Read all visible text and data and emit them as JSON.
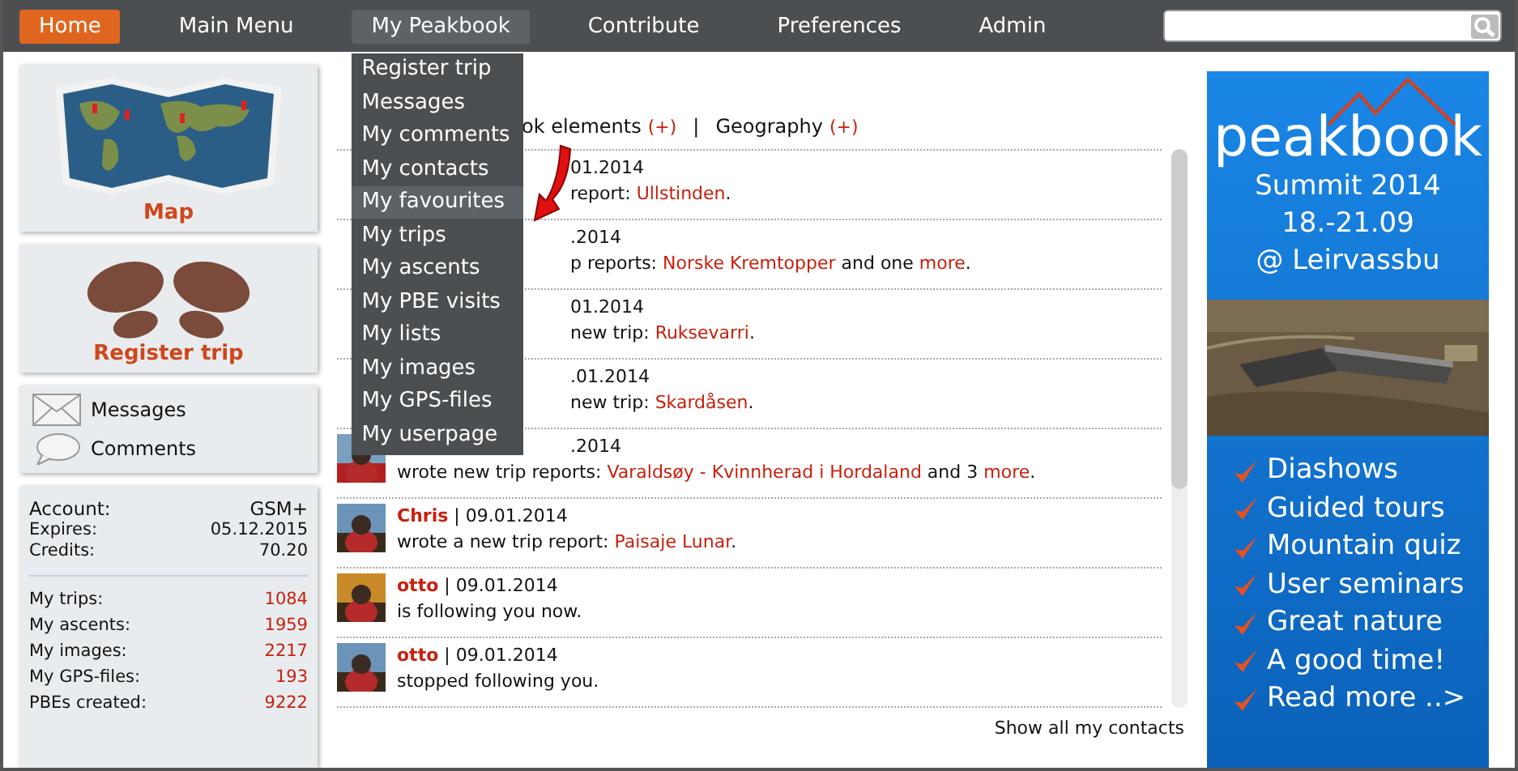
{
  "nav": {
    "items": [
      {
        "label": "Home",
        "selected": true,
        "open": false
      },
      {
        "label": "Main Menu",
        "selected": false,
        "open": false
      },
      {
        "label": "My Peakbook",
        "selected": false,
        "open": true
      },
      {
        "label": "Contribute",
        "selected": false,
        "open": false
      },
      {
        "label": "Preferences",
        "selected": false,
        "open": false
      },
      {
        "label": "Admin",
        "selected": false,
        "open": false
      }
    ],
    "search": {
      "kind": "box"
    }
  },
  "dropdown": [
    {
      "label": "Register trip",
      "selected": false
    },
    {
      "label": "Messages",
      "selected": false
    },
    {
      "label": "My comments",
      "selected": false
    },
    {
      "label": "My contacts",
      "selected": false
    },
    {
      "label": "My favourites",
      "selected": true
    },
    {
      "label": "My trips",
      "selected": false
    },
    {
      "label": "My ascents",
      "selected": false
    },
    {
      "label": "My PBE visits",
      "selected": false
    },
    {
      "label": "My lists",
      "selected": false
    },
    {
      "label": "My images",
      "selected": false
    },
    {
      "label": "My GPS-files",
      "selected": false
    },
    {
      "label": "My userpage",
      "selected": false
    }
  ],
  "sidebar": {
    "map_label": "Map",
    "register_label": "Register trip",
    "links": [
      {
        "label": "Messages",
        "kind": "envelope"
      },
      {
        "label": "Comments",
        "kind": "bubble"
      }
    ],
    "account": [
      {
        "label": "Account:",
        "value": "GSM+"
      },
      {
        "label": "Expires:",
        "value": "05.12.2015"
      },
      {
        "label": "Credits:",
        "value": "70.20"
      }
    ],
    "stats": [
      {
        "label": "My trips:",
        "value": "1084"
      },
      {
        "label": "My ascents:",
        "value": "1959"
      },
      {
        "label": "My images:",
        "value": "2217"
      },
      {
        "label": "My GPS-files:",
        "value": "193"
      },
      {
        "label": "PBEs created:",
        "value": "9222"
      }
    ]
  },
  "feed": {
    "filters": [
      {
        "label": "ok elements",
        "toggle": "(+)"
      },
      {
        "label": "Geography",
        "toggle": "(+)"
      }
    ],
    "separator": "|",
    "rows": [
      {
        "kind": "covered",
        "header": [
          {
            "text": "01.2014",
            "link": false
          }
        ],
        "line": [
          {
            "text": "report: ",
            "link": false
          },
          {
            "text": "Ullstinden",
            "link": true
          },
          {
            "text": ".",
            "link": false
          }
        ]
      },
      {
        "kind": "covered",
        "header": [
          {
            "text": ".2014",
            "link": false
          }
        ],
        "line": [
          {
            "text": "p reports: ",
            "link": false
          },
          {
            "text": "Norske Kremtopper",
            "link": true
          },
          {
            "text": " and one ",
            "link": false
          },
          {
            "text": "more",
            "link": true
          },
          {
            "text": ".",
            "link": false
          }
        ]
      },
      {
        "kind": "covered",
        "header": [
          {
            "text": "01.2014",
            "link": false
          }
        ],
        "line": [
          {
            "text": "new trip: ",
            "link": false
          },
          {
            "text": "Ruksevarri",
            "link": true
          },
          {
            "text": ".",
            "link": false
          }
        ]
      },
      {
        "kind": "covered",
        "header": [
          {
            "text": ".01.2014",
            "link": false
          }
        ],
        "line": [
          {
            "text": "new trip: ",
            "link": false
          },
          {
            "text": "Skardåsen",
            "link": true
          },
          {
            "text": ".",
            "link": false
          }
        ]
      },
      {
        "kind": "partly",
        "header": [
          {
            "text": ".2014",
            "link": false
          }
        ],
        "line": [
          {
            "text": "wrote new trip reports: ",
            "link": false
          },
          {
            "text": "Varaldsøy - Kvinnherad i Hordaland",
            "link": true
          },
          {
            "text": " and 3 ",
            "link": false
          },
          {
            "text": "more",
            "link": true
          },
          {
            "text": ".",
            "link": false
          }
        ]
      },
      {
        "kind": "open",
        "header": [
          {
            "text": "Chris",
            "link": true
          },
          {
            "text": " | 09.01.2014",
            "link": false
          }
        ],
        "line": [
          {
            "text": "wrote a new trip report: ",
            "link": false
          },
          {
            "text": "Paisaje Lunar",
            "link": true
          },
          {
            "text": ".",
            "link": false
          }
        ]
      },
      {
        "kind": "open",
        "header": [
          {
            "text": "otto",
            "link": true
          },
          {
            "text": " | 09.01.2014",
            "link": false
          }
        ],
        "line": [
          {
            "text": "is following you now.",
            "link": false
          }
        ]
      },
      {
        "kind": "open",
        "header": [
          {
            "text": "otto",
            "link": true
          },
          {
            "text": " | 09.01.2014",
            "link": false
          }
        ],
        "line": [
          {
            "text": "stopped following you.",
            "link": false
          }
        ]
      }
    ],
    "show_all": "Show all my contacts"
  },
  "banner": {
    "logo": "peakbook",
    "lines": [
      "Summit 2014",
      "18.-21.09",
      "@ Leirvassbu"
    ],
    "features": [
      "Diashows",
      "Guided tours",
      "Mountain quiz",
      "User seminars",
      "Great nature",
      "A good time!",
      "Read more ..>"
    ]
  }
}
